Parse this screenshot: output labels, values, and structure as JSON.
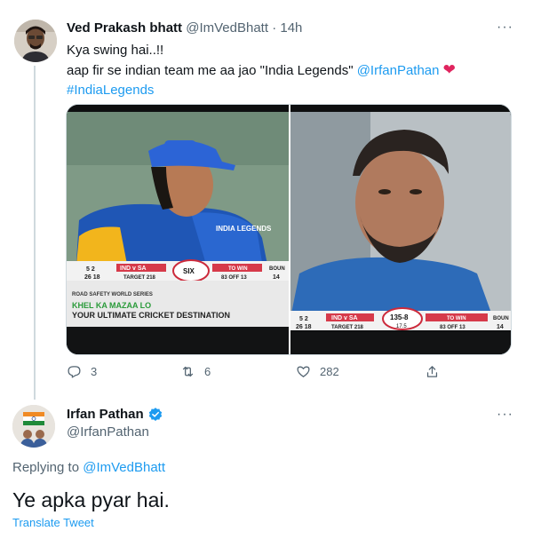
{
  "original_tweet": {
    "display_name": "Ved Prakash bhatt",
    "handle": "@ImVedBhatt",
    "separator": "·",
    "time": "14h",
    "more_label": "···",
    "line1": "Kya swing hai..!!",
    "line2_text": "aap fir se indian team me aa jao \"India Legends\"",
    "line2_mention": "@IrfanPathan",
    "line2_emoji": "❤",
    "hashtag": "#IndiaLegends",
    "media": {
      "left": {
        "jersey_text": "INDIA LEGENDS",
        "score_left": "5 2",
        "score_left2": "26 18",
        "match": "IND v SA",
        "target": "TARGET 218",
        "center": "SIX",
        "to_win": "TO WIN",
        "to_win_value": "83 OFF 13",
        "bound": "BOUN",
        "bound_value": "14",
        "banner1": "ROAD SAFETY WORLD SERIES",
        "banner2": "KHEL KA MAZAA LO",
        "banner3": "YOUR ULTIMATE CRICKET DESTINATION"
      },
      "right": {
        "score_left": "5 2",
        "score_left2": "26 18",
        "match": "IND v SA",
        "target": "TARGET 218",
        "center_score": "135-8",
        "center_overs": "17.5",
        "to_win": "TO WIN",
        "to_win_value": "83 OFF 13",
        "bound": "BOUN",
        "bound_value": "14"
      }
    },
    "actions": {
      "replies": "3",
      "retweets": "6",
      "likes": "282"
    }
  },
  "reply_tweet": {
    "display_name": "Irfan Pathan",
    "handle": "@IrfanPathan",
    "more_label": "···",
    "replying_prefix": "Replying to",
    "replying_handle": "@ImVedBhatt",
    "text": "Ye apka pyar hai.",
    "translate_label": "Translate Tweet"
  },
  "colors": {
    "link": "#1d9bf0",
    "muted": "#536471",
    "heart": "#e0245e",
    "verified": "#1d9bf0"
  }
}
